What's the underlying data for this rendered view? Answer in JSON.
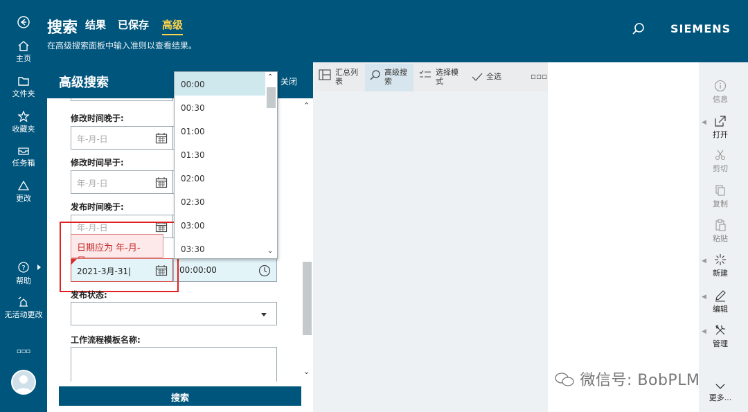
{
  "header": {
    "title": "搜索",
    "tabs": [
      {
        "label": "结果"
      },
      {
        "label": "已保存"
      },
      {
        "label": "高级"
      }
    ],
    "subtitle": "在高级搜索面板中输入准则以查看结果。",
    "brand": "SIEMENS",
    "accent_color": "#ffd44a",
    "brand_color": "#00557c"
  },
  "leftnav": {
    "items": [
      {
        "label": "主页",
        "icon": "home-icon"
      },
      {
        "label": "文件夹",
        "icon": "folder-icon"
      },
      {
        "label": "收藏夹",
        "icon": "star-icon"
      },
      {
        "label": "任务箱",
        "icon": "inbox-icon"
      },
      {
        "label": "更改",
        "icon": "triangle-icon"
      },
      {
        "label": "帮助",
        "icon": "help-icon"
      },
      {
        "label": "无活动更改",
        "icon": "no-change-icon"
      }
    ],
    "more": "▫▫▫"
  },
  "panel": {
    "title": "高级搜索",
    "close_label": "关闭",
    "fields": [
      {
        "label": "修改时间晚于:",
        "placeholder": "年-月-日"
      },
      {
        "label": "修改时间早于:",
        "placeholder": "年-月-日"
      },
      {
        "label": "发布时间晚于:",
        "placeholder": "年-月-日"
      }
    ],
    "error_message": "日期应为 年-月-日。",
    "error_value": "2021-3月-31",
    "time_value": "00:00:00",
    "status_label": "发布状态:",
    "workflow_label": "工作流程模板名称:",
    "search_button": "搜索"
  },
  "time_dropdown": {
    "options": [
      "00:00",
      "00:30",
      "01:00",
      "01:30",
      "02:00",
      "02:30",
      "03:00",
      "03:30"
    ],
    "selected": "00:00"
  },
  "toolbar": {
    "items": [
      {
        "label": "汇总列表",
        "icon": "table-icon"
      },
      {
        "label": "高级搜索",
        "icon": "search-icon"
      },
      {
        "label": "选择模式",
        "icon": "checklist-icon"
      },
      {
        "label": "全选",
        "icon": "check-icon"
      }
    ],
    "more": "▫▫▫"
  },
  "rightbar": {
    "items": [
      {
        "label": "信息",
        "icon": "info-icon"
      },
      {
        "label": "打开",
        "icon": "open-icon"
      },
      {
        "label": "剪切",
        "icon": "scissors-icon"
      },
      {
        "label": "复制",
        "icon": "copy-icon"
      },
      {
        "label": "粘贴",
        "icon": "paste-icon"
      },
      {
        "label": "新建",
        "icon": "new-icon"
      },
      {
        "label": "编辑",
        "icon": "pencil-icon"
      },
      {
        "label": "管理",
        "icon": "tools-icon"
      },
      {
        "label": "更多...",
        "icon": "chevron-down-icon"
      }
    ]
  },
  "watermark": "微信号: BobPLM"
}
